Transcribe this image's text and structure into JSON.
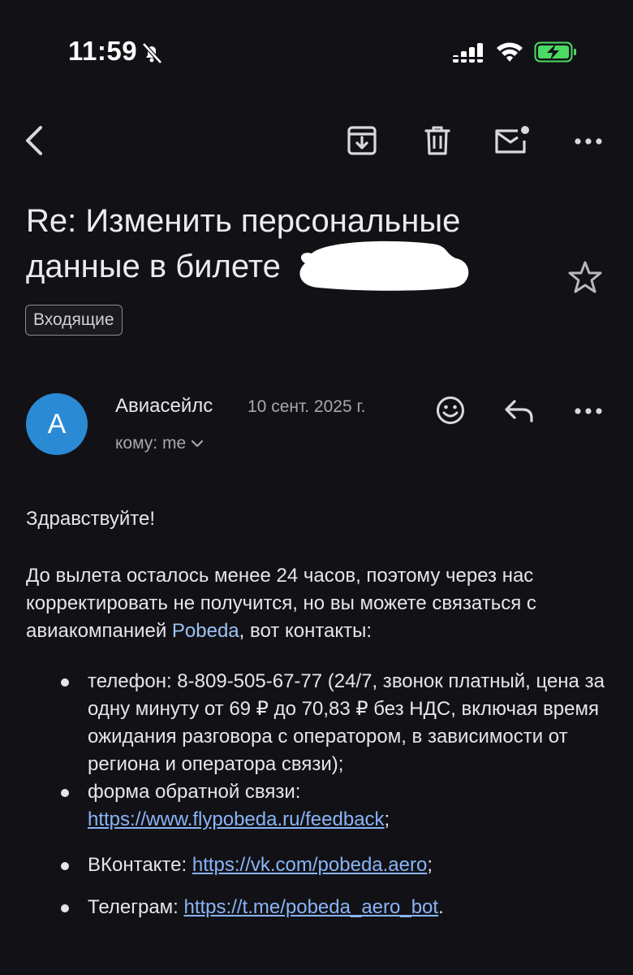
{
  "status_bar": {
    "time": "11:59"
  },
  "toolbar": {
    "back": "back-arrow-icon",
    "archive": "archive-icon",
    "delete": "trash-icon",
    "mark_unread": "mail-unread-icon",
    "more": "more-horizontal-icon"
  },
  "email": {
    "subject_line1": "Re: Изменить персональные",
    "subject_line2": "данные в билете",
    "label": "Входящие",
    "sender": {
      "avatar_letter": "А",
      "name": "Авиасейлс",
      "date": "10 сент. 2025 г.",
      "recipient": "кому: me"
    },
    "body": {
      "greeting": "Здравствуйте!",
      "para1_a": "До вылета осталось менее 24 часов, поэтому через нас корректировать не получится, но вы можете связаться с авиакомпанией ",
      "para1_link": "Pobeda",
      "para1_b": ", вот контакты:",
      "items": [
        {
          "text": "телефон: 8-809-505-67-77 (24/7, звонок платный, цена за одну минуту от 69 ₽ до 70,83 ₽ без НДС, включая время ожидания разговора с оператором, в зависимости от региона и оператора связи);"
        },
        {
          "prefix": "форма обратной связи: ",
          "link": "https://www.flypobeda.ru/feedback",
          "suffix": ";"
        },
        {
          "prefix": "ВКонтакте: ",
          "link": "https://vk.com/pobeda.aero",
          "suffix": ";"
        },
        {
          "prefix": "Телеграм: ",
          "link": "https://t.me/pobeda_aero_bot",
          "suffix": "."
        }
      ]
    }
  },
  "colors": {
    "background": "#121216",
    "link": "#8ab4f8",
    "avatar": "#2a8ad4",
    "battery": "#4cd964"
  }
}
